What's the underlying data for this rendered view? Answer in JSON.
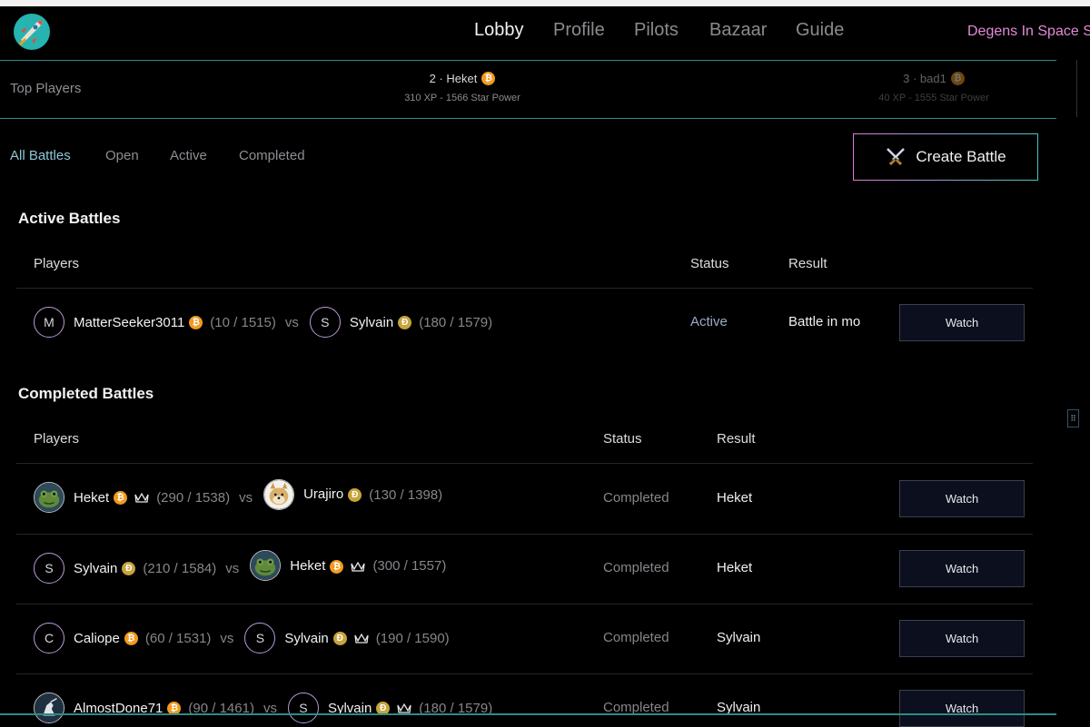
{
  "nav": {
    "items": [
      "Lobby",
      "Profile",
      "Pilots",
      "Bazaar",
      "Guide"
    ],
    "active": "Lobby",
    "brand": "Degens In Space St"
  },
  "top_players": {
    "label": "Top Players",
    "entries": [
      {
        "rank_name": "2 · Heket",
        "coin": "btc",
        "sub": "310 XP - 1566 Star Power"
      },
      {
        "rank_name": "3 · bad1",
        "coin": "btc",
        "sub": "40 XP - 1555 Star Power"
      }
    ]
  },
  "tabs": [
    "All Battles",
    "Open",
    "Active",
    "Completed"
  ],
  "create_button": "Create Battle",
  "active_section": {
    "title": "Active Battles",
    "headers": {
      "players": "Players",
      "status": "Status",
      "result": "Result"
    },
    "rows": [
      {
        "p1": {
          "avatar": "M",
          "name": "MatterSeeker3011",
          "coin": "btc",
          "stats": "(10 / 1515)"
        },
        "vs": "vs",
        "p2": {
          "avatar": "S",
          "name": "Sylvain",
          "coin": "doge",
          "stats": "(180 / 1579)"
        },
        "status": "Active",
        "result": "Battle in mo",
        "action": "Watch"
      }
    ]
  },
  "completed_section": {
    "title": "Completed Battles",
    "headers": {
      "players": "Players",
      "status": "Status",
      "result": "Result"
    },
    "rows": [
      {
        "p1": {
          "avatar": "frog",
          "name": "Heket",
          "coin": "btc",
          "crown": true,
          "stats": "(290 / 1538)"
        },
        "vs": "vs",
        "p2": {
          "avatar": "dog",
          "name": "Urajiro",
          "coin": "doge",
          "crown": false,
          "stats": "(130 / 1398)"
        },
        "status": "Completed",
        "result": "Heket",
        "action": "Watch"
      },
      {
        "p1": {
          "avatar": "S",
          "name": "Sylvain",
          "coin": "doge",
          "crown": false,
          "stats": "(210 / 1584)"
        },
        "vs": "vs",
        "p2": {
          "avatar": "frog",
          "name": "Heket",
          "coin": "btc",
          "crown": true,
          "stats": "(300 / 1557)"
        },
        "status": "Completed",
        "result": "Heket",
        "action": "Watch"
      },
      {
        "p1": {
          "avatar": "C",
          "name": "Caliope",
          "coin": "btc",
          "crown": false,
          "stats": "(60 / 1531)"
        },
        "vs": "vs",
        "p2": {
          "avatar": "S",
          "name": "Sylvain",
          "coin": "doge",
          "crown": true,
          "stats": "(190 / 1590)"
        },
        "status": "Completed",
        "result": "Sylvain",
        "action": "Watch"
      },
      {
        "p1": {
          "avatar": "knight",
          "name": "AlmostDone71",
          "coin": "btc",
          "crown": false,
          "stats": "(90 / 1461)"
        },
        "vs": "vs",
        "p2": {
          "avatar": "S",
          "name": "Sylvain",
          "coin": "doge",
          "crown": true,
          "stats": "(180 / 1579)"
        },
        "status": "Completed",
        "result": "Sylvain",
        "action": "Watch"
      }
    ]
  },
  "colors": {
    "accent_teal": "#2f8b86",
    "accent_pink": "#e07ad8",
    "btc": "#f39a1e",
    "doge": "#c7a43c"
  }
}
